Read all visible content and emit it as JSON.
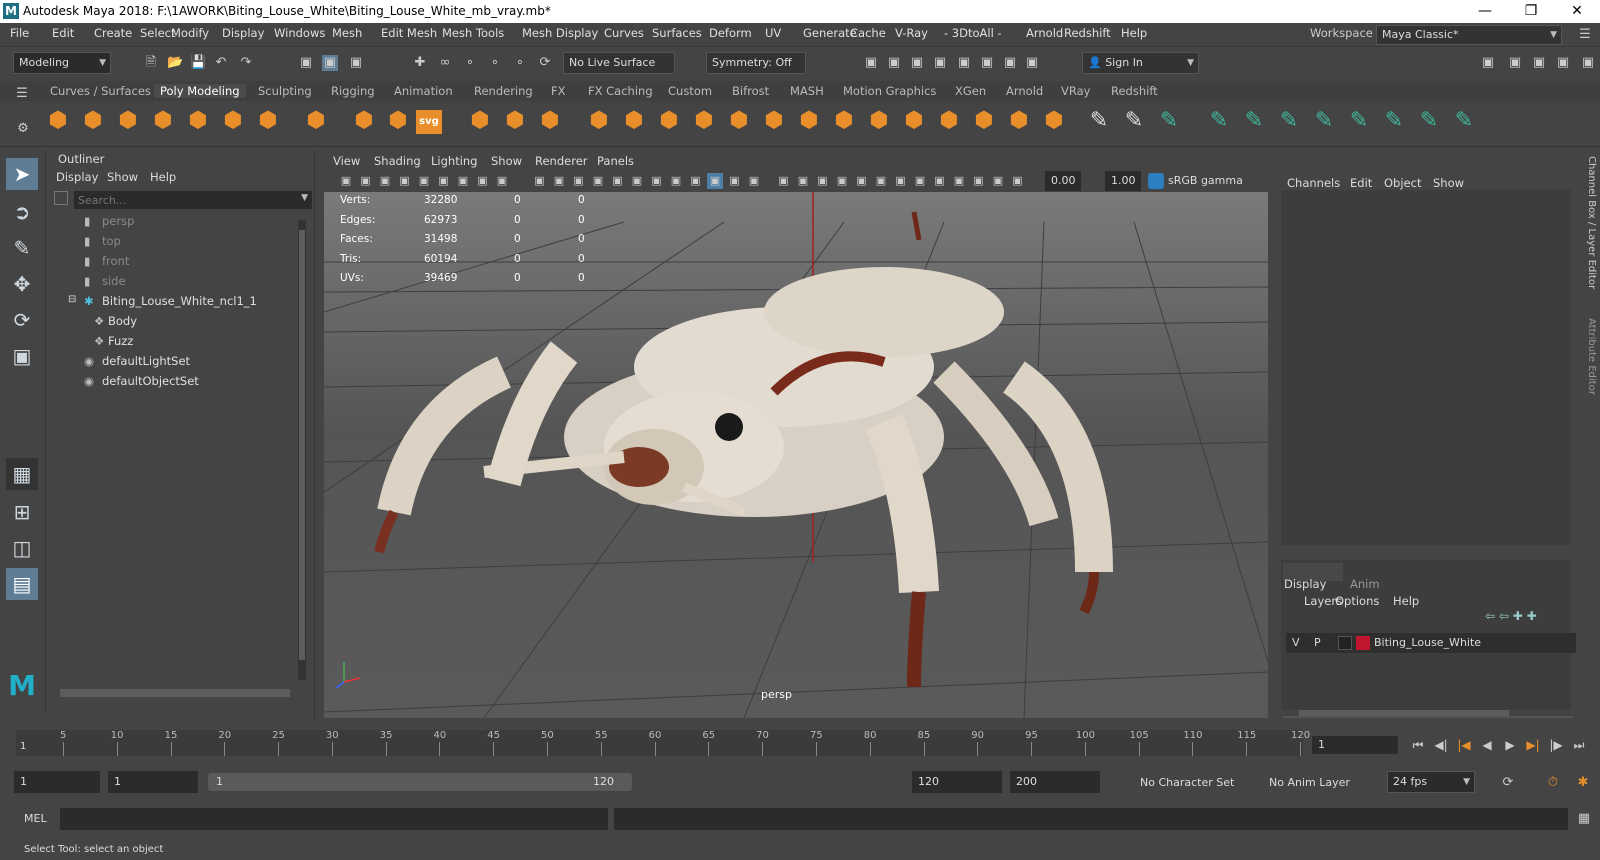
{
  "window": {
    "title": "Autodesk Maya 2018: F:\\1AWORK\\Biting_Louse_White\\Biting_Louse_White_mb_vray.mb*",
    "logo": "M",
    "controls": [
      "minimize-icon",
      "maximize-icon",
      "close-icon"
    ]
  },
  "menubar": {
    "items": [
      "File",
      "Edit",
      "Create",
      "Select",
      "Modify",
      "Display",
      "Windows",
      "Mesh",
      "Edit Mesh",
      "Mesh Tools",
      "Mesh Display",
      "Curves",
      "Surfaces",
      "Deform",
      "UV",
      "Generate",
      "Cache",
      "V-Ray",
      "- 3DtoAll -",
      "Arnold",
      "Redshift",
      "Help"
    ],
    "workspace_label": "Workspace :",
    "workspace_value": "Maya Classic*"
  },
  "statusline": {
    "mode": "Modeling",
    "live_surface": "No Live Surface",
    "symmetry": "Symmetry: Off",
    "sign_in": "Sign In"
  },
  "shelf": {
    "tabs": [
      "Curves / Surfaces",
      "Poly Modeling",
      "Sculpting",
      "Rigging",
      "Animation",
      "Rendering",
      "FX",
      "FX Caching",
      "Custom",
      "Bifrost",
      "MASH",
      "Motion Graphics",
      "XGen",
      "Arnold",
      "VRay",
      "Redshift"
    ],
    "active_tab": "Poly Modeling",
    "svg_label": "svg"
  },
  "outliner": {
    "title": "Outliner",
    "menu": [
      "Display",
      "Show",
      "Help"
    ],
    "search_placeholder": "Search...",
    "items": [
      {
        "label": "persp",
        "dim": true
      },
      {
        "label": "top",
        "dim": true
      },
      {
        "label": "front",
        "dim": true
      },
      {
        "label": "side",
        "dim": true
      },
      {
        "label": "Biting_Louse_White_ncl1_1",
        "dim": false
      },
      {
        "label": "Body",
        "dim": false
      },
      {
        "label": "Fuzz",
        "dim": false
      },
      {
        "label": "defaultLightSet",
        "dim": false
      },
      {
        "label": "defaultObjectSet",
        "dim": false
      }
    ]
  },
  "viewport": {
    "menu": [
      "View",
      "Shading",
      "Lighting",
      "Show",
      "Renderer",
      "Panels"
    ],
    "exposure": "0.00",
    "gamma": "1.00",
    "color_space": "sRGB gamma",
    "camera": "persp",
    "hud": [
      {
        "label": "Verts:",
        "v1": "32280",
        "v2": "0",
        "v3": "0"
      },
      {
        "label": "Edges:",
        "v1": "62973",
        "v2": "0",
        "v3": "0"
      },
      {
        "label": "Faces:",
        "v1": "31498",
        "v2": "0",
        "v3": "0"
      },
      {
        "label": "Tris:",
        "v1": "60194",
        "v2": "0",
        "v3": "0"
      },
      {
        "label": "UVs:",
        "v1": "39469",
        "v2": "0",
        "v3": "0"
      }
    ]
  },
  "channel": {
    "menu": [
      "Channels",
      "Edit",
      "Object",
      "Show"
    ],
    "side_tabs": [
      "Channel Box / Layer Editor",
      "Attribute Editor"
    ],
    "layer_tabs": [
      "Display",
      "Anim"
    ],
    "layer_menu": [
      "Layers",
      "Options",
      "Help"
    ],
    "layer": {
      "v": "V",
      "p": "P",
      "name": "Biting_Louse_White",
      "color": "#c0162e"
    }
  },
  "timeline": {
    "ticks": [
      "5",
      "10",
      "15",
      "20",
      "25",
      "30",
      "35",
      "40",
      "45",
      "50",
      "55",
      "60",
      "65",
      "70",
      "75",
      "80",
      "85",
      "90",
      "95",
      "100",
      "105",
      "110",
      "115",
      "120"
    ],
    "current_frame_field": "1",
    "playhead": "1"
  },
  "range": {
    "start": "1",
    "inner_start": "1",
    "slider_start": "1",
    "slider_end": "120",
    "end": "120",
    "max": "200",
    "character_set": "No Character Set",
    "anim_layer": "No Anim Layer",
    "fps": "24 fps"
  },
  "cmd": {
    "label": "MEL"
  },
  "help": {
    "text": "Select Tool: select an object"
  }
}
